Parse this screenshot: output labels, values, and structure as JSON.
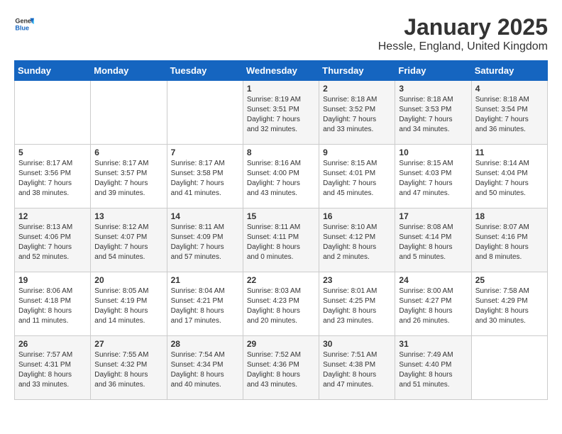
{
  "header": {
    "logo_general": "General",
    "logo_blue": "Blue",
    "month_title": "January 2025",
    "location": "Hessle, England, United Kingdom"
  },
  "weekdays": [
    "Sunday",
    "Monday",
    "Tuesday",
    "Wednesday",
    "Thursday",
    "Friday",
    "Saturday"
  ],
  "weeks": [
    [
      {
        "day": "",
        "content": ""
      },
      {
        "day": "",
        "content": ""
      },
      {
        "day": "",
        "content": ""
      },
      {
        "day": "1",
        "content": "Sunrise: 8:19 AM\nSunset: 3:51 PM\nDaylight: 7 hours\nand 32 minutes."
      },
      {
        "day": "2",
        "content": "Sunrise: 8:18 AM\nSunset: 3:52 PM\nDaylight: 7 hours\nand 33 minutes."
      },
      {
        "day": "3",
        "content": "Sunrise: 8:18 AM\nSunset: 3:53 PM\nDaylight: 7 hours\nand 34 minutes."
      },
      {
        "day": "4",
        "content": "Sunrise: 8:18 AM\nSunset: 3:54 PM\nDaylight: 7 hours\nand 36 minutes."
      }
    ],
    [
      {
        "day": "5",
        "content": "Sunrise: 8:17 AM\nSunset: 3:56 PM\nDaylight: 7 hours\nand 38 minutes."
      },
      {
        "day": "6",
        "content": "Sunrise: 8:17 AM\nSunset: 3:57 PM\nDaylight: 7 hours\nand 39 minutes."
      },
      {
        "day": "7",
        "content": "Sunrise: 8:17 AM\nSunset: 3:58 PM\nDaylight: 7 hours\nand 41 minutes."
      },
      {
        "day": "8",
        "content": "Sunrise: 8:16 AM\nSunset: 4:00 PM\nDaylight: 7 hours\nand 43 minutes."
      },
      {
        "day": "9",
        "content": "Sunrise: 8:15 AM\nSunset: 4:01 PM\nDaylight: 7 hours\nand 45 minutes."
      },
      {
        "day": "10",
        "content": "Sunrise: 8:15 AM\nSunset: 4:03 PM\nDaylight: 7 hours\nand 47 minutes."
      },
      {
        "day": "11",
        "content": "Sunrise: 8:14 AM\nSunset: 4:04 PM\nDaylight: 7 hours\nand 50 minutes."
      }
    ],
    [
      {
        "day": "12",
        "content": "Sunrise: 8:13 AM\nSunset: 4:06 PM\nDaylight: 7 hours\nand 52 minutes."
      },
      {
        "day": "13",
        "content": "Sunrise: 8:12 AM\nSunset: 4:07 PM\nDaylight: 7 hours\nand 54 minutes."
      },
      {
        "day": "14",
        "content": "Sunrise: 8:11 AM\nSunset: 4:09 PM\nDaylight: 7 hours\nand 57 minutes."
      },
      {
        "day": "15",
        "content": "Sunrise: 8:11 AM\nSunset: 4:11 PM\nDaylight: 8 hours\nand 0 minutes."
      },
      {
        "day": "16",
        "content": "Sunrise: 8:10 AM\nSunset: 4:12 PM\nDaylight: 8 hours\nand 2 minutes."
      },
      {
        "day": "17",
        "content": "Sunrise: 8:08 AM\nSunset: 4:14 PM\nDaylight: 8 hours\nand 5 minutes."
      },
      {
        "day": "18",
        "content": "Sunrise: 8:07 AM\nSunset: 4:16 PM\nDaylight: 8 hours\nand 8 minutes."
      }
    ],
    [
      {
        "day": "19",
        "content": "Sunrise: 8:06 AM\nSunset: 4:18 PM\nDaylight: 8 hours\nand 11 minutes."
      },
      {
        "day": "20",
        "content": "Sunrise: 8:05 AM\nSunset: 4:19 PM\nDaylight: 8 hours\nand 14 minutes."
      },
      {
        "day": "21",
        "content": "Sunrise: 8:04 AM\nSunset: 4:21 PM\nDaylight: 8 hours\nand 17 minutes."
      },
      {
        "day": "22",
        "content": "Sunrise: 8:03 AM\nSunset: 4:23 PM\nDaylight: 8 hours\nand 20 minutes."
      },
      {
        "day": "23",
        "content": "Sunrise: 8:01 AM\nSunset: 4:25 PM\nDaylight: 8 hours\nand 23 minutes."
      },
      {
        "day": "24",
        "content": "Sunrise: 8:00 AM\nSunset: 4:27 PM\nDaylight: 8 hours\nand 26 minutes."
      },
      {
        "day": "25",
        "content": "Sunrise: 7:58 AM\nSunset: 4:29 PM\nDaylight: 8 hours\nand 30 minutes."
      }
    ],
    [
      {
        "day": "26",
        "content": "Sunrise: 7:57 AM\nSunset: 4:31 PM\nDaylight: 8 hours\nand 33 minutes."
      },
      {
        "day": "27",
        "content": "Sunrise: 7:55 AM\nSunset: 4:32 PM\nDaylight: 8 hours\nand 36 minutes."
      },
      {
        "day": "28",
        "content": "Sunrise: 7:54 AM\nSunset: 4:34 PM\nDaylight: 8 hours\nand 40 minutes."
      },
      {
        "day": "29",
        "content": "Sunrise: 7:52 AM\nSunset: 4:36 PM\nDaylight: 8 hours\nand 43 minutes."
      },
      {
        "day": "30",
        "content": "Sunrise: 7:51 AM\nSunset: 4:38 PM\nDaylight: 8 hours\nand 47 minutes."
      },
      {
        "day": "31",
        "content": "Sunrise: 7:49 AM\nSunset: 4:40 PM\nDaylight: 8 hours\nand 51 minutes."
      },
      {
        "day": "",
        "content": ""
      }
    ]
  ]
}
